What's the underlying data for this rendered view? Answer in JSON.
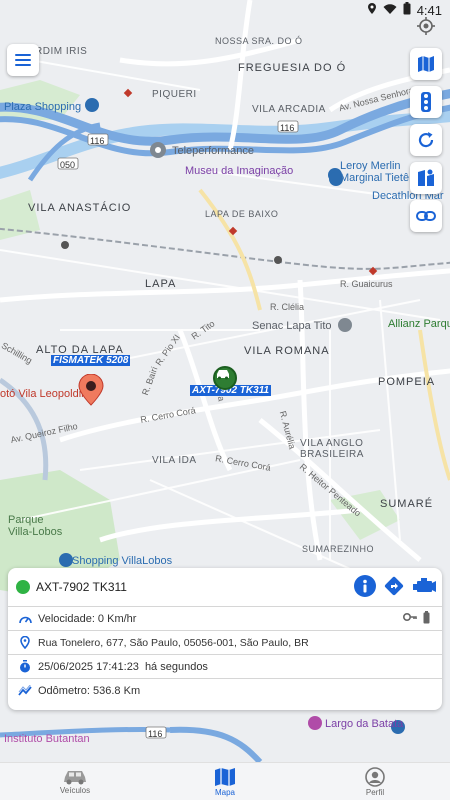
{
  "status_bar": {
    "time": "4:41"
  },
  "map": {
    "labels": {
      "freguesia": "FREGUESIA DO Ó",
      "vila_anastacio": "VILA ANASTÁCIO",
      "lapa": "LAPA",
      "lapa_de_baixo": "LAPA DE BAIXO",
      "alto_da_lapa": "ALTO DA LAPA",
      "vila_romana": "VILA ROMANA",
      "pompeia": "POMPEIA",
      "vila_ida": "VILA IDA",
      "vila_anglo": "VILA ANGLO\nBRASILEIRA",
      "sumare": "SUMARÉ",
      "sumarezinho": "SUMAREZINHO",
      "piqueri": "PIQUERI",
      "vila_arcadia": "VILA ARCADIA",
      "nossa_senhora": "NOSSA\nSRA. DO Ó",
      "jardim_iris": "RDIM IRIS",
      "plaza_shopping": "Plaza Shopping",
      "teleperformance": "Teleperformance",
      "museu": "Museu da Imaginação",
      "leroy": "Leroy Merlin\nMarginal Tietê",
      "decathlon": "Decathlon Mar",
      "senac": "Senac Lapa Tito",
      "allianz": "Allianz Parque",
      "shopping_villa": "Shopping VillaLobos",
      "parque_villa": "Parque\nVilla-Lobos",
      "largo_batata": "Largo da Batata",
      "instituto": "Instituto Butantan",
      "vila_leopoldina": "otó Vila Leopoldin",
      "r_clelia": "R. Clélia",
      "r_guaicurus": "R. Guaicurus",
      "r_tito": "R. Tito",
      "r_pio_xi": "R. Pio XI",
      "r_cerro_cora": "R. Cerro Corá",
      "r_cerro_cora2": "R. Cerro Corá",
      "av_queiroz": "Av. Queiroz Filho",
      "r_heitor": "R. Heitor Penteado",
      "r_aurelia": "R. Aurélia",
      "av_nossa_senhora": "Av. Nossa Senhora",
      "r_bairi": "R. Bairi",
      "schilling": "Schilling",
      "rua_label": "Rua",
      "route_116a": "116",
      "route_116b": "116",
      "route_050": "050",
      "route_116c": "116"
    },
    "vehicle_tags": {
      "fismatek": "FISMATEK 5208",
      "axt": "AXT-7902 TK311"
    }
  },
  "vehicle_card": {
    "name": "AXT-7902 TK311",
    "status_color": "#2fb344",
    "speed": "Velocidade: 0 Km/hr",
    "address": "Rua Tonelero, 677, São Paulo, 05056-001, São Paulo, BR",
    "datetime": "25/06/2025 17:41:23",
    "elapsed": "há segundos",
    "odometer": "Odômetro: 536.8 Km"
  },
  "bottom_nav": {
    "items": [
      {
        "label": "Veículos"
      },
      {
        "label": "Mapa"
      },
      {
        "label": "Perfil"
      }
    ]
  },
  "colors": {
    "accent": "#1a63d6",
    "road_highway": "#7aa9e0",
    "online": "#2fb344"
  }
}
